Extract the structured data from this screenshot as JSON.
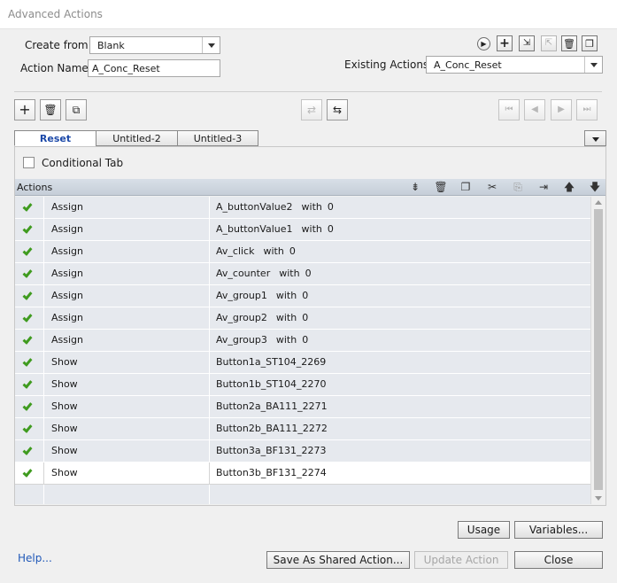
{
  "window": {
    "title": "Advanced Actions"
  },
  "create_from": {
    "label": "Create from:",
    "value": "Blank"
  },
  "action_name": {
    "label": "Action Name:",
    "value": "A_Conc_Reset"
  },
  "existing_actions": {
    "label": "Existing Actions:",
    "value": "A_Conc_Reset"
  },
  "tabs": [
    {
      "label": "Reset",
      "active": true
    },
    {
      "label": "Untitled-2",
      "active": false
    },
    {
      "label": "Untitled-3",
      "active": false
    }
  ],
  "conditional_tab": {
    "label": "Conditional Tab",
    "checked": false
  },
  "grid": {
    "header": "Actions",
    "rows": [
      {
        "action": "Assign",
        "target": "A_buttonValue2",
        "with": "with",
        "value": "0"
      },
      {
        "action": "Assign",
        "target": "A_buttonValue1",
        "with": "with",
        "value": "0"
      },
      {
        "action": "Assign",
        "target": "Av_click",
        "with": "with",
        "value": "0"
      },
      {
        "action": "Assign",
        "target": "Av_counter",
        "with": "with",
        "value": "0"
      },
      {
        "action": "Assign",
        "target": "Av_group1",
        "with": "with",
        "value": "0"
      },
      {
        "action": "Assign",
        "target": "Av_group2",
        "with": "with",
        "value": "0"
      },
      {
        "action": "Assign",
        "target": "Av_group3",
        "with": "with",
        "value": "0"
      },
      {
        "action": "Show",
        "target": "Button1a_ST104_2269"
      },
      {
        "action": "Show",
        "target": "Button1b_ST104_2270"
      },
      {
        "action": "Show",
        "target": "Button2a_BA111_2271"
      },
      {
        "action": "Show",
        "target": "Button2b_BA111_2272"
      },
      {
        "action": "Show",
        "target": "Button3a_BF131_2273"
      },
      {
        "action": "Show",
        "target": "Button3b_BF131_2274"
      }
    ],
    "selected_row": 12
  },
  "buttons": {
    "usage": "Usage",
    "variables": "Variables...",
    "save_shared": "Save As Shared Action...",
    "update_action": "Update Action",
    "close": "Close"
  },
  "help": "Help...",
  "colors": {
    "check": "#3f9b1f",
    "link": "#2159b8",
    "active_tab": "#1c49a8"
  }
}
